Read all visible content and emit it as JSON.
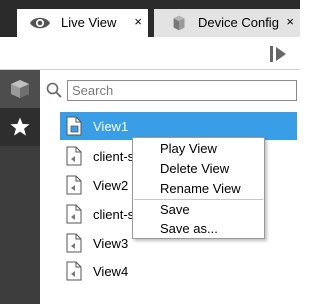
{
  "tabs": [
    {
      "label": "Live View",
      "close": "×",
      "icon": "eye-icon",
      "active": true
    },
    {
      "label": "Device Config",
      "close": "×",
      "icon": "device-config-icon",
      "active": false
    }
  ],
  "search": {
    "placeholder": "Search",
    "value": ""
  },
  "rail": [
    {
      "icon": "devices-cube-icon"
    },
    {
      "icon": "favorites-star-icon"
    }
  ],
  "tree": {
    "items": [
      {
        "label": "View1",
        "selected": true
      },
      {
        "label": "client-s",
        "selected": false
      },
      {
        "label": "View2",
        "selected": false
      },
      {
        "label": "client-s",
        "selected": false
      },
      {
        "label": "View3",
        "selected": false
      },
      {
        "label": "View4",
        "selected": false
      }
    ]
  },
  "context_menu": {
    "items": [
      "Play View",
      "Delete View",
      "Rename View",
      "Save",
      "Save as..."
    ]
  },
  "colors": {
    "selection": "#3a9ee6",
    "tabbar": "#2a2a2a",
    "rail": "#3c3c3c"
  }
}
